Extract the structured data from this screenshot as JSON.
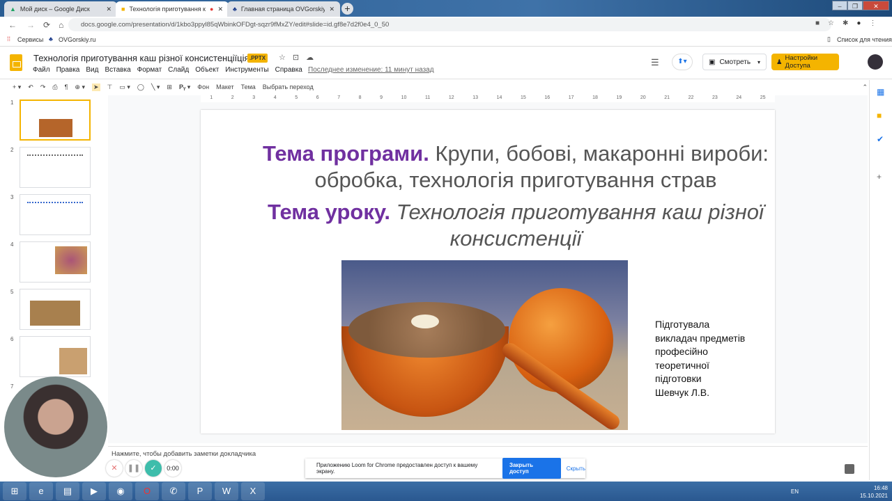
{
  "browser": {
    "tabs": [
      {
        "title": "Мой диск – Google Диск",
        "active": false
      },
      {
        "title": "Технологія приготування ка",
        "active": true,
        "recording": true
      },
      {
        "title": "Главная страница OVGorskiy",
        "active": false
      }
    ],
    "url": "docs.google.com/presentation/d/1kbo3ppyl85qWbinkOFDgt-sqzr9fMxZY/edit#slide=id.gf8e7d2f0e4_0_50",
    "bookmarks": [
      "Сервисы",
      "OVGorskiy.ru"
    ],
    "reading_list": "Список для чтения"
  },
  "app": {
    "title": "Технологія приготування  каш різної консистенціїція",
    "badge": ".PPTX",
    "menu": [
      "Файл",
      "Правка",
      "Вид",
      "Вставка",
      "Формат",
      "Слайд",
      "Объект",
      "Инструменты",
      "Справка"
    ],
    "last_edit": "Последнее изменение: 11 минут назад",
    "present_label": "Смотреть",
    "share_label": "Настройки Доступа",
    "accent": "#f4b400"
  },
  "toolbar": {
    "background": "Фон",
    "layout": "Макет",
    "theme": "Тема",
    "transition": "Выбрать переход"
  },
  "ruler": [
    "1",
    "2",
    "3",
    "4",
    "5",
    "6",
    "7",
    "8",
    "9",
    "10",
    "11",
    "12",
    "13",
    "14",
    "15",
    "16",
    "17",
    "18",
    "19",
    "20",
    "21",
    "22",
    "23",
    "24",
    "25"
  ],
  "filmstrip": [
    "1",
    "2",
    "3",
    "4",
    "5",
    "6",
    "7"
  ],
  "slide": {
    "topic_label": "Тема програми.",
    "topic_text": " Крупи, бобові, макаронні вироби: обробка, технологія приготування страв",
    "lesson_label": "Тема уроку.",
    "lesson_text": " Технологія приготування  каш різної консистенції",
    "credit": "Підготувала\nвикладач предметів\nпрофесійно\nтеоретичної\nпідготовки\nШевчук Л.В.",
    "title_color": "#7030a0"
  },
  "notes_placeholder": "Нажмите, чтобы добавить заметки докладчика",
  "recorder": {
    "timer": "0:00"
  },
  "loom": {
    "message": "Приложению Loom for Chrome предоставлен доступ к вашему экрану.",
    "stop": "Закрыть доступ",
    "hide": "Скрыть"
  },
  "tray": {
    "lang": "EN",
    "time": "16:48",
    "date": "15.10.2021"
  }
}
